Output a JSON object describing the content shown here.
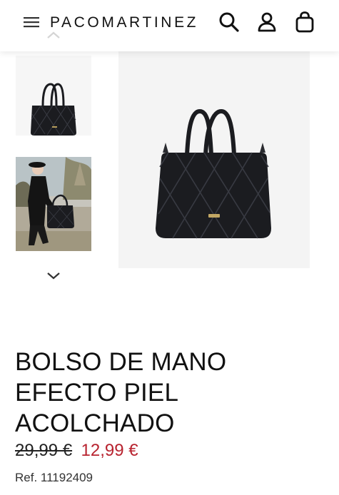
{
  "header": {
    "brand": "PACOMARTINEZ",
    "icons": [
      "menu-icon",
      "search-icon",
      "user-icon",
      "shopping-bag-icon"
    ]
  },
  "gallery": {
    "thumbnails": [
      "bag-product-thumbnail",
      "model-with-bag-thumbnail"
    ],
    "nav_icons": [
      "chevron-up-icon",
      "chevron-down-icon"
    ]
  },
  "product": {
    "title_lines": [
      "BOLSO DE MANO",
      "EFECTO PIEL",
      "ACOLCHADO"
    ],
    "old_price": "29,99 €",
    "price": "12,99 €",
    "reference": "Ref. 11192409"
  },
  "colors": {
    "price_red": "#b8232f",
    "bag_black": "#1b1c20",
    "image_background": "#f4f4f4"
  }
}
